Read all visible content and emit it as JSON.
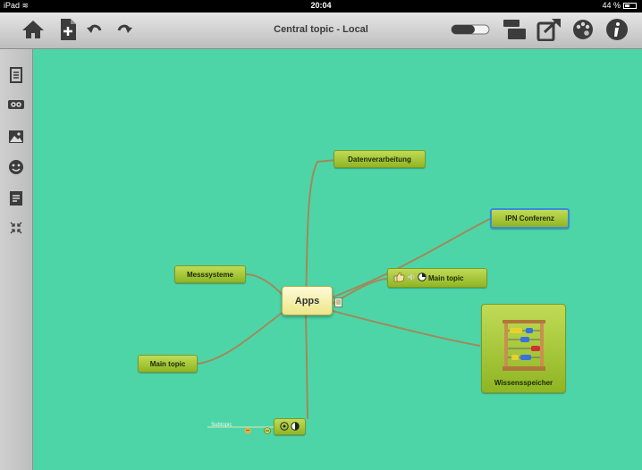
{
  "status_bar": {
    "device": "iPad",
    "time": "20:04",
    "battery": "44 %"
  },
  "toolbar": {
    "title": "Central topic - Local"
  },
  "colors": {
    "canvas": "#4dd5a8",
    "branch": "#a08a5a",
    "node_green": "#a6c63a",
    "central": "#f6f0b0",
    "selection": "#3a8ae0"
  },
  "icons": {
    "toolbar": [
      "home-icon",
      "add-document-icon",
      "undo-icon",
      "redo-icon",
      "toggle-icon",
      "presentation-icon",
      "export-icon",
      "palette-icon",
      "info-icon"
    ],
    "sidebar": [
      "notes-icon",
      "link-icon",
      "image-icon",
      "smiley-icon",
      "task-icon",
      "collapse-icon"
    ]
  },
  "mindmap": {
    "central": "Apps",
    "topics": [
      "Datenverarbeitung",
      "IPN Conferenz",
      "Main topic",
      "Messsysteme",
      "Main topic",
      "Wissensspeicher"
    ],
    "subtopic": "Subtopic"
  }
}
